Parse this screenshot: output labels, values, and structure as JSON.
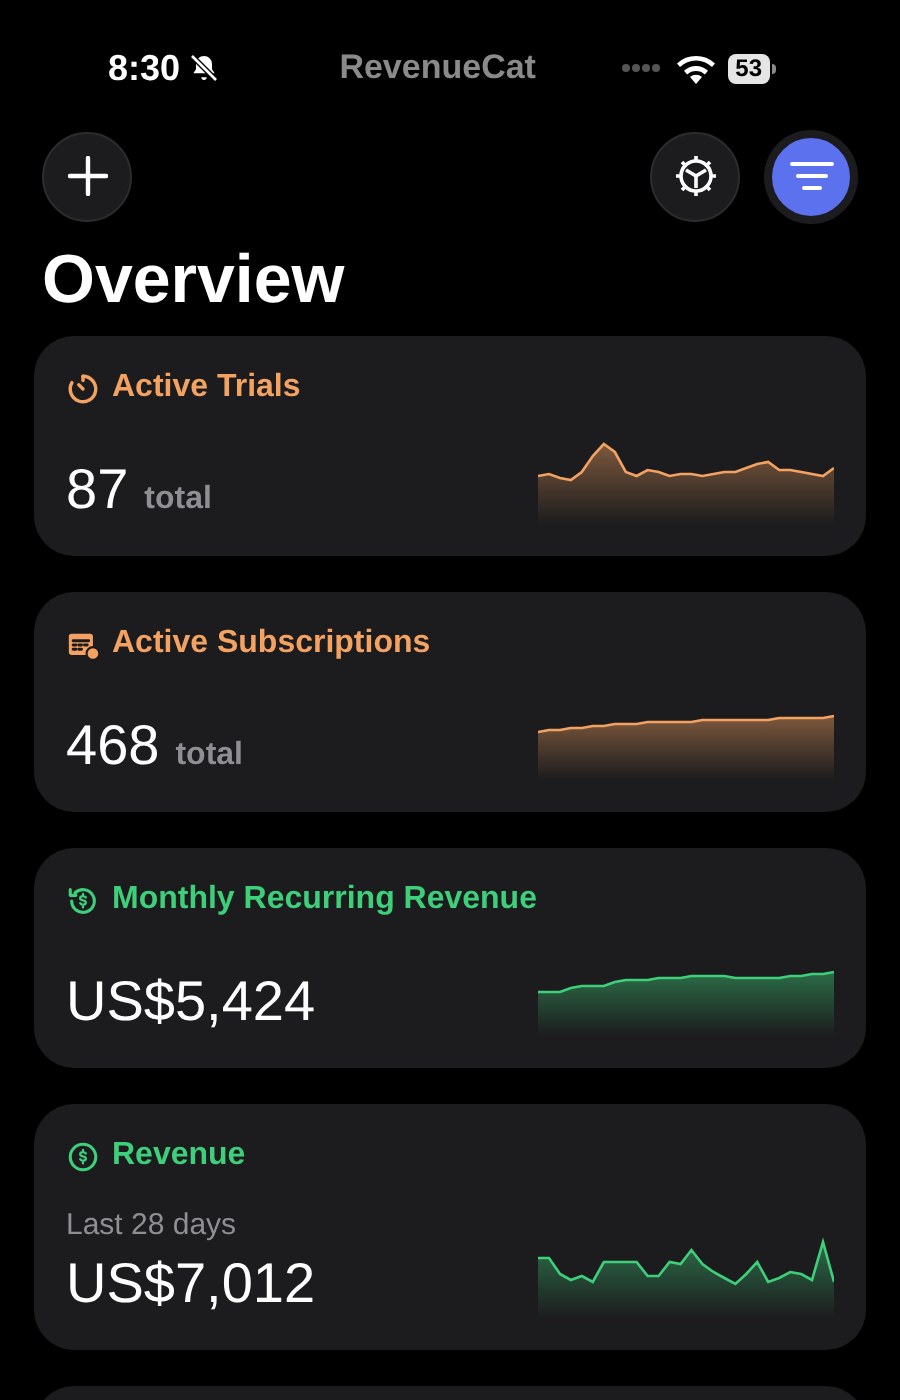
{
  "status_bar": {
    "time": "8:30",
    "logo": "RevenueCat",
    "battery": "53"
  },
  "title": "Overview",
  "cards": [
    {
      "title": "Active Trials",
      "color": "#f4a261",
      "value": "87",
      "unit": "total"
    },
    {
      "title": "Active Subscriptions",
      "color": "#f4a261",
      "value": "468",
      "unit": "total"
    },
    {
      "title": "Monthly Recurring Revenue",
      "color": "#3ecf7a",
      "value": "US$5,424"
    },
    {
      "title": "Revenue",
      "color": "#3ecf7a",
      "subtitle": "Last 28 days",
      "value": "US$7,012"
    }
  ]
}
